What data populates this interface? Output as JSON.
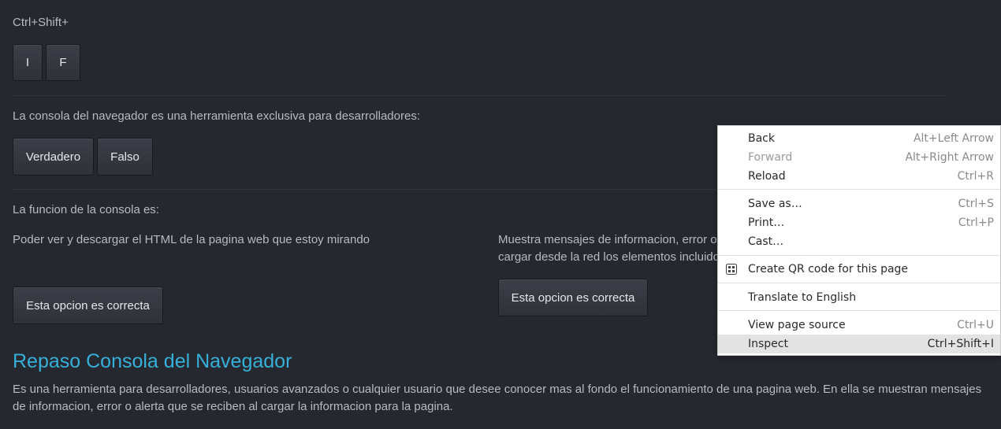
{
  "shortcut": {
    "label": "Ctrl+Shift+",
    "keys": [
      "I",
      "F"
    ]
  },
  "question1": {
    "text": "La consola del navegador es una herramienta exclusiva para desarrolladores:",
    "options": [
      "Verdadero",
      "Falso"
    ]
  },
  "question2": {
    "text": "La funcion de la consola es:",
    "option_a": {
      "text": "Poder ver y descargar el HTML de la pagina web que estoy mirando",
      "button": "Esta opcion es correcta"
    },
    "option_b": {
      "line1": "Muestra mensajes de informacion, error o",
      "line2": "cargar desde la red los elementos incluidos",
      "button": "Esta opcion es correcta"
    }
  },
  "summary": {
    "title": "Repaso Consola del Navegador",
    "line1": "Es una herramienta para desarrolladores, usuarios avanzados o cualquier usuario que desee conocer mas al fondo el funcionamiento de una pagina web. En ella se muestran mensajes",
    "line2": "de informacion, error o alerta que se reciben al cargar la informacion para la pagina."
  },
  "context_menu": {
    "back": {
      "label": "Back",
      "shortcut": "Alt+Left Arrow"
    },
    "forward": {
      "label": "Forward",
      "shortcut": "Alt+Right Arrow"
    },
    "reload": {
      "label": "Reload",
      "shortcut": "Ctrl+R"
    },
    "save_as": {
      "label": "Save as…",
      "shortcut": "Ctrl+S"
    },
    "print": {
      "label": "Print…",
      "shortcut": "Ctrl+P"
    },
    "cast": {
      "label": "Cast…"
    },
    "qr": {
      "label": "Create QR code for this page",
      "icon": "qr-code-icon"
    },
    "translate": {
      "label": "Translate to English"
    },
    "view_source": {
      "label": "View page source",
      "shortcut": "Ctrl+U"
    },
    "inspect": {
      "label": "Inspect",
      "shortcut": "Ctrl+Shift+I"
    }
  },
  "colors": {
    "background": "#262830",
    "heading": "#36b0d8",
    "menu_background": "#ffffff",
    "menu_hover": "#e3e3e3"
  }
}
